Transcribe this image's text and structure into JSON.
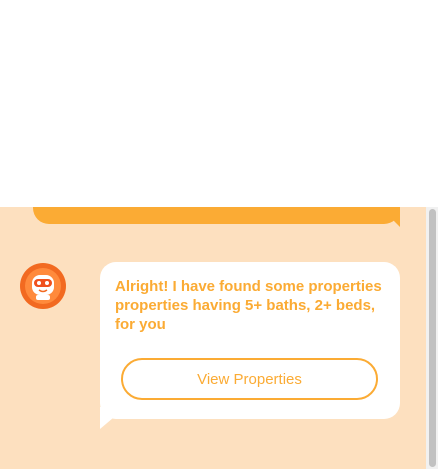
{
  "chat": {
    "bot_message": "Alright! I have found some properties properties having 5+ baths, 2+ beds, for you",
    "view_properties_label": "View Properties"
  },
  "colors": {
    "panel_background": "#fde0bf",
    "accent": "#fbab34",
    "avatar": "#f26a21",
    "bubble": "#ffffff"
  },
  "icons": {
    "avatar": "robot-icon"
  }
}
